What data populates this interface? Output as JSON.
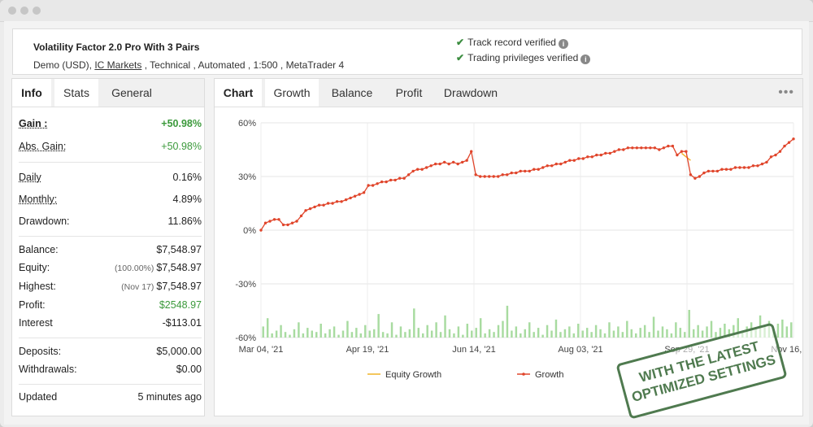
{
  "system": {
    "title": "Volatility Factor 2.0 Pro With 3 Pairs",
    "sub_account": "Demo (USD), ",
    "sub_broker": "IC Markets",
    "sub_rest": " , Technical , Automated , 1:500 , MetaTrader 4",
    "verify1": "Track record verified",
    "verify2": "Trading privileges verified",
    "info_glyph": "i"
  },
  "left_tabs": [
    "Info",
    "Stats",
    "General"
  ],
  "stats": {
    "gain": {
      "label": "Gain :",
      "value": "+50.98%"
    },
    "abs_gain": {
      "label": "Abs. Gain:",
      "value": "+50.98%"
    },
    "daily": {
      "label": "Daily",
      "value": "0.16%"
    },
    "monthly": {
      "label": "Monthly:",
      "value": "4.89%"
    },
    "drawdown": {
      "label": "Drawdown:",
      "value": "11.86%"
    },
    "balance": {
      "label": "Balance:",
      "value": "$7,548.97"
    },
    "equity": {
      "label": "Equity:",
      "pre": "(100.00%)",
      "value": "$7,548.97"
    },
    "highest": {
      "label": "Highest:",
      "pre": "(Nov 17)",
      "value": "$7,548.97"
    },
    "profit": {
      "label": "Profit:",
      "value": "$2548.97"
    },
    "interest": {
      "label": "Interest",
      "value": "-$113.01"
    },
    "deposits": {
      "label": "Deposits:",
      "value": "$5,000.00"
    },
    "withdrawals": {
      "label": "Withdrawals:",
      "value": "$0.00"
    },
    "updated": {
      "label": "Updated",
      "value": "5 minutes ago"
    }
  },
  "chart_tabs": [
    "Chart",
    "Growth",
    "Balance",
    "Profit",
    "Drawdown"
  ],
  "menu_glyph": "•••",
  "colors": {
    "growth": "#e0452b",
    "equity": "#f0b429",
    "bars": "#a8dba0",
    "positive": "#3c9a3c",
    "check": "#3c8d40"
  },
  "stamp": {
    "line1": "WITH THE LATEST",
    "line2": "OPTIMIZED SETTINGS"
  },
  "chart_data": {
    "type": "line",
    "ylim": [
      -60,
      60
    ],
    "yticks": [
      "60%",
      "30%",
      "0%",
      "-30%",
      "-60%"
    ],
    "xticks": [
      "Mar 04, '21",
      "Apr 19, '21",
      "Jun 14, '21",
      "Aug 03, '21",
      "Sep 29, '21",
      "Nov 16, '21"
    ],
    "legend": [
      "Equity Growth",
      "Growth"
    ],
    "legend_position": "bottom",
    "series": [
      {
        "name": "Growth",
        "x_index": [
          0,
          1,
          2,
          3,
          4,
          5,
          6,
          7,
          8,
          9,
          10,
          11,
          12,
          13,
          14,
          15,
          16,
          17,
          18,
          19,
          20,
          21,
          22,
          23,
          24,
          25,
          26,
          27,
          28,
          29,
          30,
          31,
          32,
          33,
          34,
          35,
          36,
          37,
          38,
          39,
          40,
          41,
          42,
          43,
          44,
          45,
          46,
          47,
          48,
          49,
          50,
          51,
          52,
          53,
          54,
          55,
          56,
          57,
          58,
          59,
          60,
          61,
          62,
          63,
          64,
          65,
          66,
          67,
          68,
          69,
          70,
          71,
          72,
          73,
          74,
          75,
          76,
          77,
          78,
          79,
          80,
          81,
          82,
          83,
          84,
          85,
          86,
          87,
          88,
          89,
          90,
          91,
          92,
          93,
          94,
          95,
          96,
          97,
          98,
          99,
          100,
          101,
          102,
          103,
          104,
          105,
          106,
          107,
          108,
          109,
          110,
          111,
          112,
          113,
          114,
          115,
          116,
          117,
          118,
          119
        ],
        "values": [
          0,
          4,
          5,
          6,
          6,
          3,
          3,
          4,
          5,
          8,
          11,
          12,
          13,
          14,
          14,
          15,
          15,
          16,
          16,
          17,
          18,
          19,
          20,
          21,
          25,
          25,
          26,
          27,
          27,
          28,
          28,
          29,
          29,
          31,
          33,
          34,
          34,
          35,
          36,
          37,
          37,
          38,
          37,
          38,
          37,
          38,
          39,
          44,
          31,
          30,
          30,
          30,
          30,
          30,
          31,
          31,
          32,
          32,
          33,
          33,
          33,
          34,
          34,
          35,
          36,
          36,
          37,
          37,
          38,
          39,
          39,
          40,
          40,
          41,
          41,
          42,
          42,
          43,
          43,
          44,
          45,
          45,
          46,
          46,
          46,
          46,
          46,
          46,
          46,
          45,
          46,
          47,
          47,
          42,
          44,
          44,
          31,
          29,
          30,
          32,
          33,
          33,
          33,
          34,
          34,
          34,
          35,
          35,
          35,
          35,
          36,
          36,
          37,
          38,
          41,
          42,
          44,
          47,
          49,
          51
        ]
      },
      {
        "name": "Equity Growth",
        "x_index": [
          94,
          95,
          96
        ],
        "values": [
          43,
          41,
          39
        ]
      }
    ],
    "daily_bars": [
      8,
      14,
      3,
      5,
      9,
      4,
      2,
      6,
      11,
      3,
      7,
      5,
      4,
      10,
      3,
      6,
      8,
      2,
      5,
      12,
      4,
      7,
      3,
      9,
      5,
      6,
      17,
      4,
      3,
      11,
      2,
      8,
      4,
      6,
      21,
      7,
      3,
      9,
      5,
      11,
      4,
      16,
      6,
      3,
      8,
      2,
      10,
      5,
      7,
      14,
      3,
      6,
      4,
      9,
      12,
      23,
      5,
      8,
      3,
      6,
      11,
      4,
      7,
      2,
      9,
      5,
      13,
      4,
      6,
      8,
      3,
      10,
      5,
      7,
      4,
      9,
      6,
      3,
      11,
      5,
      8,
      4,
      12,
      6,
      3,
      7,
      9,
      4,
      15,
      5,
      8,
      6,
      3,
      11,
      7,
      4,
      20,
      6,
      9,
      5,
      8,
      12,
      4,
      7,
      10,
      6,
      9,
      14,
      5,
      8,
      11,
      7,
      16,
      9,
      12,
      6,
      10,
      13,
      8,
      11
    ]
  }
}
